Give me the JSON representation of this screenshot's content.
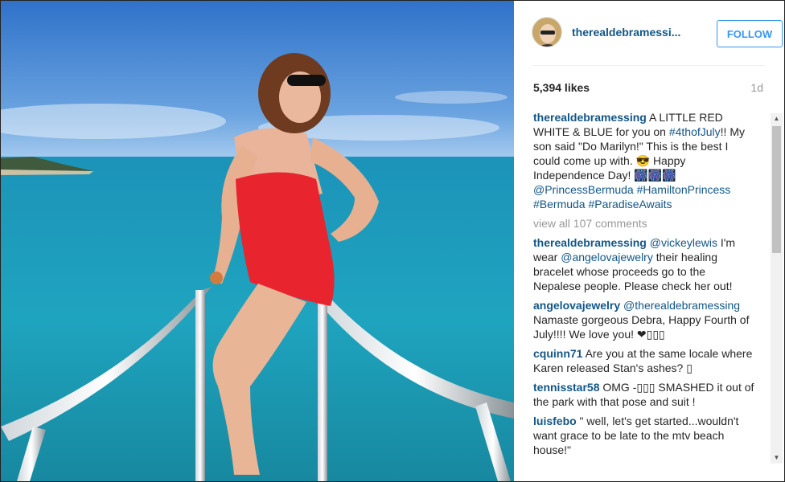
{
  "post": {
    "username": "therealdebramessi...",
    "follow_label": "FOLLOW",
    "likes": "5,394 likes",
    "time": "1d"
  },
  "caption": {
    "user": "therealdebramessing",
    "text1": " A LITTLE RED WHITE & BLUE for you on ",
    "tag1": "#4thofJuly",
    "text2": "!! My son said \"Do Marilyn!\" This is the best I could come up with. 😎 Happy Independence Day! 🎆🎆🎆 ",
    "mention": "@PrincessBermuda",
    "tags": " #HamiltonPrincess #Bermuda #ParadiseAwaits"
  },
  "view_all": "view all 107 comments",
  "comments": [
    {
      "user": "therealdebramessing",
      "mention": " @vickeylewis",
      "text": " I'm wear ",
      "mention2": "@angelovajewelry",
      "text2": " their healing bracelet whose proceeds go to the Nepalese people. Please check her out!"
    },
    {
      "user": "angelovajewelry",
      "mention": " @therealdebramessing",
      "text": " Namaste gorgeous Debra, Happy Fourth of July!!!! We love you! ❤▯▯▯",
      "mention2": "",
      "text2": ""
    },
    {
      "user": "cquinn71",
      "mention": "",
      "text": " Are you at the same locale where Karen released Stan's ashes? ▯",
      "mention2": "",
      "text2": ""
    },
    {
      "user": "tennisstar58",
      "mention": "",
      "text": " OMG -▯▯▯ SMASHED it out of the park with that pose and suit !",
      "mention2": "",
      "text2": ""
    },
    {
      "user": "luisfebo",
      "mention": "",
      "text": " \" well, let's get started...wouldn't want grace to be late to the mtv beach house!\"",
      "mention2": "",
      "text2": ""
    }
  ],
  "colors": {
    "link": "#125688",
    "follow": "#3897f0",
    "sea": "#1a9bb5",
    "sky": "#3b7fd1",
    "swimsuit": "#e8242e"
  }
}
